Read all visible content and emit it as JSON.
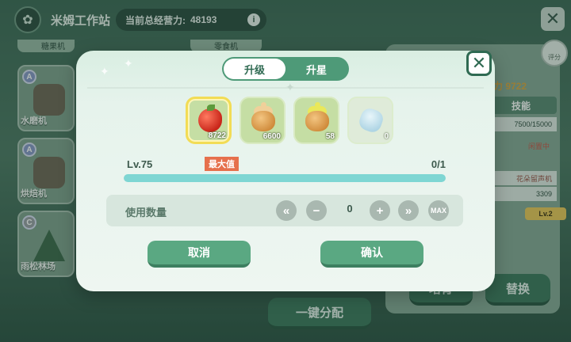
{
  "header": {
    "title": "米姆工作站",
    "power_label": "当前总经营力:",
    "power_value": "48193"
  },
  "background": {
    "stations": [
      {
        "grade": "A",
        "name": "水磨机"
      },
      {
        "grade": "A",
        "name": "烘焙机"
      },
      {
        "grade": "C",
        "name": "雨松林场"
      }
    ],
    "top_row": [
      "糖果机",
      "零食机"
    ],
    "right_panel": {
      "power_partial": "力 9722",
      "rate_label": "评分",
      "tab_label": "技能",
      "progress": "7500/15000",
      "status": "闲置中",
      "machine": "花朵留声机",
      "count": "3309",
      "level": "Lv.2"
    },
    "assign_button": "一键分配",
    "swap_button": "替换",
    "other_button": "培育"
  },
  "modal": {
    "tabs": [
      {
        "label": "升级",
        "active": true
      },
      {
        "label": "升星",
        "active": false
      }
    ],
    "items": [
      {
        "icon": "red-berry-icon",
        "qty": "8722",
        "selected": true
      },
      {
        "icon": "honey-jar-icon",
        "qty": "6600",
        "selected": false
      },
      {
        "icon": "green-lid-jar-icon",
        "qty": "58",
        "selected": false
      },
      {
        "icon": "blue-crystal-icon",
        "qty": "0",
        "selected": false
      }
    ],
    "level_label": "Lv.75",
    "max_badge": "最大值",
    "exp_text": "0/1",
    "exp_fraction": 1.0,
    "quantity_label": "使用数量",
    "quantity_value": "0",
    "controls": {
      "min": "«",
      "minus": "−",
      "plus": "+",
      "more": "»",
      "max": "MAX"
    },
    "cancel_label": "取消",
    "confirm_label": "确认"
  },
  "colors": {
    "accent": "#5aa882",
    "selected_border": "#f2dc55",
    "exp_fill": "#7ed6d3",
    "max_badge": "#e6704c"
  }
}
